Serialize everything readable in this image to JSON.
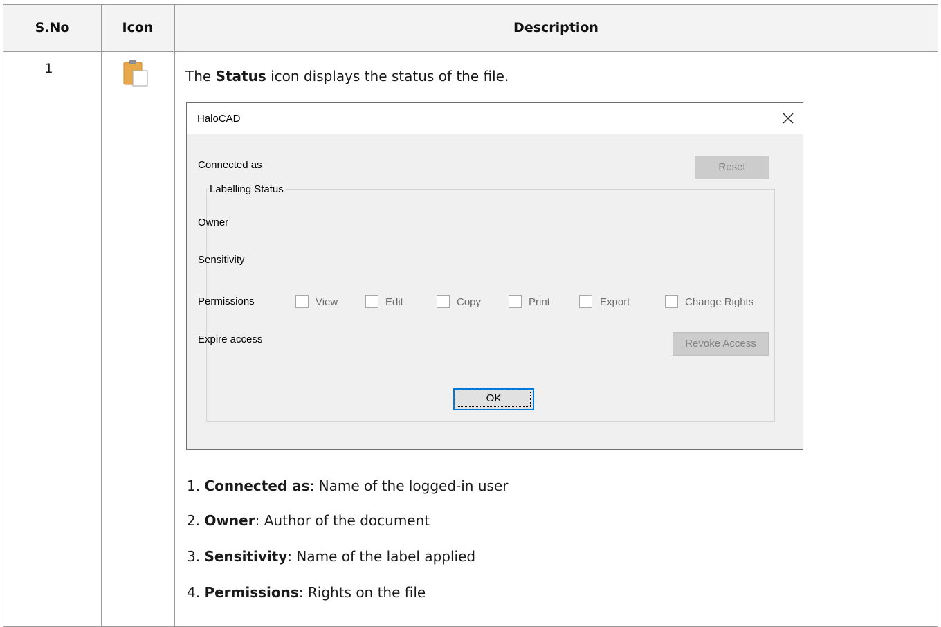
{
  "table": {
    "headers": {
      "sno": "S.No",
      "icon": "Icon",
      "description": "Description"
    },
    "row": {
      "sno": "1",
      "icon_name": "status-clipboard-icon",
      "intro_prefix": "The ",
      "intro_bold": "Status",
      "intro_suffix": " icon displays the status of the file."
    },
    "items": [
      {
        "num": "1. ",
        "term": "Connected as",
        "desc": ": Name of the logged-in user"
      },
      {
        "num": "2. ",
        "term": "Owner",
        "desc": ": Author of the document"
      },
      {
        "num": "3. ",
        "term": "Sensitivity",
        "desc": ": Name of the label applied"
      },
      {
        "num": "4. ",
        "term": "Permissions",
        "desc": ": Rights on the file"
      }
    ]
  },
  "dialog": {
    "title": "HaloCAD",
    "connected_as": "Connected as",
    "reset": "Reset",
    "group_title": "Labelling Status",
    "owner": "Owner",
    "sensitivity": "Sensitivity",
    "permissions_label": "Permissions",
    "permissions": [
      "View",
      "Edit",
      "Copy",
      "Print",
      "Export",
      "Change Rights"
    ],
    "expire_access": "Expire access",
    "revoke_access": "Revoke Access",
    "ok": "OK"
  },
  "colors": {
    "header_bg": "#f3f3f3",
    "dialog_bg": "#f0f0f0",
    "ok_focus_border": "#0078d7",
    "icon_orange": "#e8a94c"
  }
}
